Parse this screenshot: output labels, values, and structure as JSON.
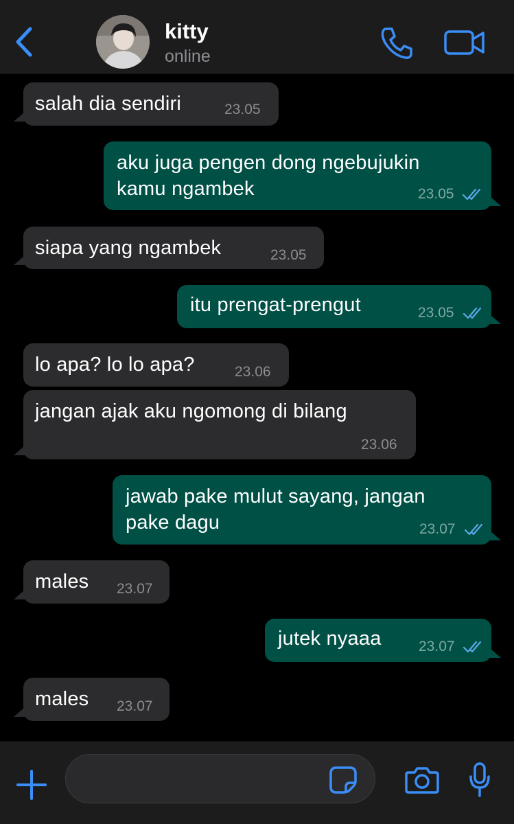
{
  "header": {
    "contact_name": "kitty",
    "status": "online",
    "icons": {
      "back": "chevron-left-icon",
      "call": "phone-icon",
      "video": "video-camera-icon"
    }
  },
  "messages": [
    {
      "direction": "in",
      "text": "salah dia sendiri",
      "time": "23.05"
    },
    {
      "direction": "out",
      "text": "aku juga pengen dong ngebujukin\nkamu ngambek",
      "time": "23.05",
      "read": true
    },
    {
      "direction": "in",
      "text": "siapa yang ngambek",
      "time": "23.05"
    },
    {
      "direction": "out",
      "text": "itu prengat-prengut",
      "time": "23.05",
      "read": true
    },
    {
      "direction": "in",
      "text": "lo apa? lo lo apa?",
      "time": "23.06"
    },
    {
      "direction": "in",
      "text": "jangan ajak aku ngomong di bilang",
      "time": "23.06"
    },
    {
      "direction": "out",
      "text": "jawab pake mulut sayang, jangan\npake dagu",
      "time": "23.07",
      "read": true
    },
    {
      "direction": "in",
      "text": "males",
      "time": "23.07"
    },
    {
      "direction": "out",
      "text": "jutek nyaaa",
      "time": "23.07",
      "read": true
    },
    {
      "direction": "in",
      "text": "males",
      "time": "23.07"
    }
  ],
  "input": {
    "placeholder": "",
    "value": ""
  },
  "colors": {
    "accent": "#3a8ef6",
    "incoming_bubble": "#2c2c2e",
    "outgoing_bubble": "#005046",
    "read_ticks": "#5aa9e6",
    "background": "#000000"
  }
}
